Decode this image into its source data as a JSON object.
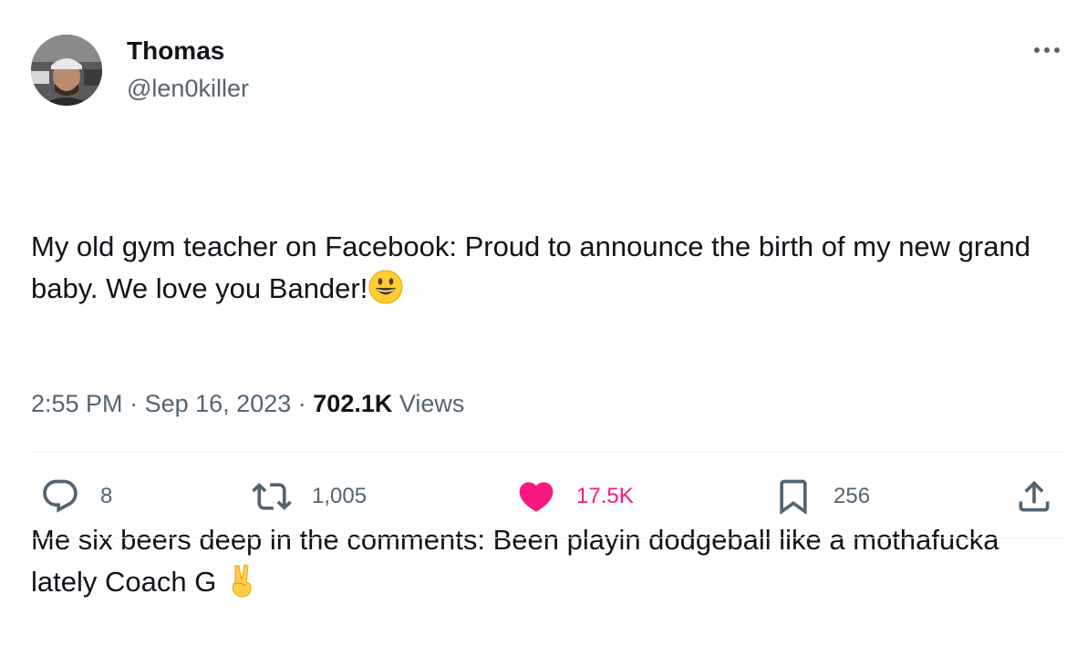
{
  "author": {
    "display_name": "Thomas",
    "handle": "@len0killer",
    "avatar_icon": "profile-photo"
  },
  "tweet": {
    "paragraph_1": "My old gym teacher on Facebook: Proud to announce the birth of my new grand baby. We love you Bander!",
    "paragraph_1_emoji": "smiling-face-emoji",
    "paragraph_2": "Me six beers deep in the comments: Been playin dodgeball like a mothafucka lately Coach G",
    "paragraph_2_emoji": "victory-hand-emoji"
  },
  "meta": {
    "time": "2:55 PM",
    "separator": "·",
    "date": "Sep 16, 2023",
    "views_count": "702.1K",
    "views_label": "Views"
  },
  "actions": {
    "replies": "8",
    "retweets": "1,005",
    "likes": "17.5K",
    "bookmarks": "256"
  },
  "colors": {
    "text": "#0f1419",
    "secondary": "#536471",
    "like": "#f91880",
    "divider": "#eff3f4"
  }
}
